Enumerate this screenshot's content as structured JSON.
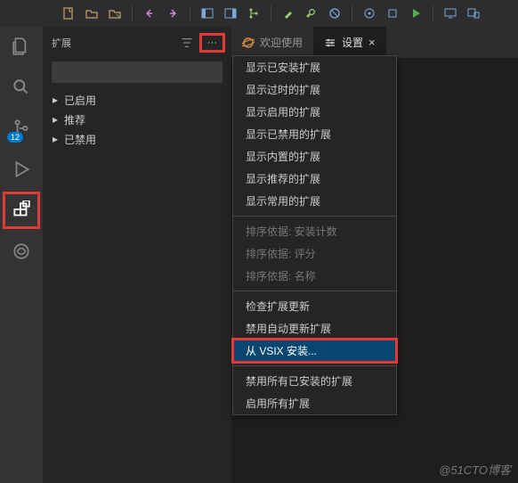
{
  "toolbar": {
    "icons": [
      "new-file",
      "open-folder",
      "open-file",
      "undo",
      "redo",
      "layout-left",
      "layout-right",
      "git-branch",
      "brush",
      "wrench",
      "cancel",
      "target",
      "square",
      "play",
      "monitor",
      "devices"
    ]
  },
  "activity": {
    "items": [
      {
        "name": "files-icon",
        "badge": null
      },
      {
        "name": "search-icon",
        "badge": null
      },
      {
        "name": "source-control-icon",
        "badge": "12"
      },
      {
        "name": "debug-icon",
        "badge": null
      },
      {
        "name": "extensions-icon",
        "badge": null,
        "boxed": true,
        "active": true
      },
      {
        "name": "circle-icon",
        "badge": null
      }
    ]
  },
  "sidebar": {
    "title": "扩展",
    "filter_name": "filter-icon",
    "more_label": "···",
    "search_placeholder": "",
    "sections": [
      {
        "label": "已启用",
        "chev": "▸"
      },
      {
        "label": "推荐",
        "chev": "▸"
      },
      {
        "label": "已禁用",
        "chev": "▸"
      }
    ]
  },
  "tabs": [
    {
      "label": "欢迎使用",
      "icon": "planet-icon",
      "active": false
    },
    {
      "label": "设置",
      "icon": "settings-icon",
      "active": true,
      "close": "×"
    }
  ],
  "menu": {
    "groups": [
      [
        {
          "label": "显示已安装扩展",
          "dis": false
        },
        {
          "label": "显示过时的扩展",
          "dis": false
        },
        {
          "label": "显示启用的扩展",
          "dis": false
        },
        {
          "label": "显示已禁用的扩展",
          "dis": false
        },
        {
          "label": "显示内置的扩展",
          "dis": false
        },
        {
          "label": "显示推荐的扩展",
          "dis": false
        },
        {
          "label": "显示常用的扩展",
          "dis": false
        }
      ],
      [
        {
          "label": "排序依据: 安装计数",
          "dis": true
        },
        {
          "label": "排序依据: 评分",
          "dis": true
        },
        {
          "label": "排序依据: 名称",
          "dis": true
        }
      ],
      [
        {
          "label": "检查扩展更新",
          "dis": false
        },
        {
          "label": "禁用自动更新扩展",
          "dis": false
        },
        {
          "label": "从 VSIX 安装...",
          "dis": false,
          "sel": true,
          "boxed": true
        }
      ],
      [
        {
          "label": "禁用所有已安装的扩展",
          "dis": false
        },
        {
          "label": "启用所有扩展",
          "dis": false
        }
      ]
    ]
  },
  "watermark": "@51CTO博客",
  "colors": {
    "accent": "#007acc",
    "highlight": "#e53935",
    "menuSel": "#094771"
  }
}
